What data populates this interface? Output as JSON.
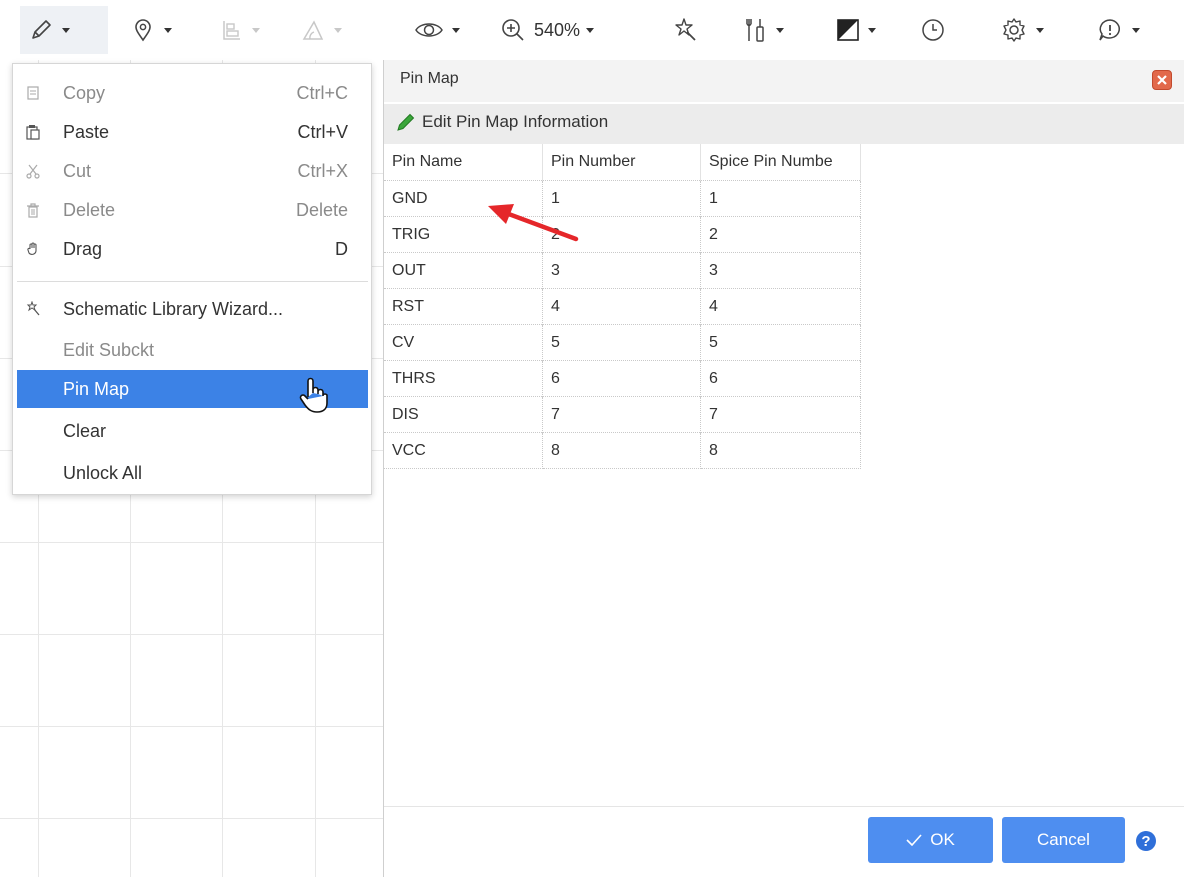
{
  "toolbar": {
    "zoom": "540%",
    "items": [
      {
        "icon": "pencil-icon"
      },
      {
        "icon": "location-pin-icon"
      },
      {
        "icon": "align-icon"
      },
      {
        "icon": "shape-icon"
      },
      {
        "icon": "eye-icon"
      },
      {
        "icon": "zoom-in-icon"
      },
      {
        "icon": "wizard-icon"
      },
      {
        "icon": "tools-icon"
      },
      {
        "icon": "theme-icon"
      },
      {
        "icon": "history-icon"
      },
      {
        "icon": "gear-icon"
      },
      {
        "icon": "alert-icon"
      }
    ]
  },
  "menu": {
    "items": [
      {
        "label": "Copy",
        "shortcut": "Ctrl+C",
        "icon": "copy-icon",
        "disabled": true
      },
      {
        "label": "Paste",
        "shortcut": "Ctrl+V",
        "icon": "paste-icon",
        "disabled": false
      },
      {
        "label": "Cut",
        "shortcut": "Ctrl+X",
        "icon": "scissors-icon",
        "disabled": true
      },
      {
        "label": "Delete",
        "shortcut": "Delete",
        "icon": "trash-icon",
        "disabled": true
      },
      {
        "label": "Drag",
        "shortcut": "D",
        "icon": "hand-icon",
        "disabled": false
      },
      {
        "label": "Schematic Library Wizard...",
        "shortcut": "",
        "icon": "wizard-icon",
        "disabled": false
      },
      {
        "label": "Edit Subckt",
        "shortcut": "",
        "icon": "",
        "disabled": true
      },
      {
        "label": "Pin Map",
        "shortcut": "",
        "icon": "",
        "disabled": false,
        "highlighted": true
      },
      {
        "label": "Clear",
        "shortcut": "",
        "icon": "",
        "disabled": false
      },
      {
        "label": "Unlock All",
        "shortcut": "",
        "icon": "",
        "disabled": false
      }
    ]
  },
  "dialog": {
    "title": "Pin Map",
    "edit_label": "Edit Pin Map Information",
    "columns": [
      "Pin Name",
      "Pin Number",
      "Spice Pin Numbe"
    ],
    "rows": [
      [
        "GND",
        "1",
        "1"
      ],
      [
        "TRIG",
        "2",
        "2"
      ],
      [
        "OUT",
        "3",
        "3"
      ],
      [
        "RST",
        "4",
        "4"
      ],
      [
        "CV",
        "5",
        "5"
      ],
      [
        "THRS",
        "6",
        "6"
      ],
      [
        "DIS",
        "7",
        "7"
      ],
      [
        "VCC",
        "8",
        "8"
      ]
    ],
    "ok_label": "OK",
    "cancel_label": "Cancel",
    "help_symbol": "?"
  },
  "colors": {
    "accent": "#4e8ef0",
    "menu_highlight": "#3c82e6",
    "close_button": "#e2694b",
    "annotation_arrow": "#e5272a"
  }
}
